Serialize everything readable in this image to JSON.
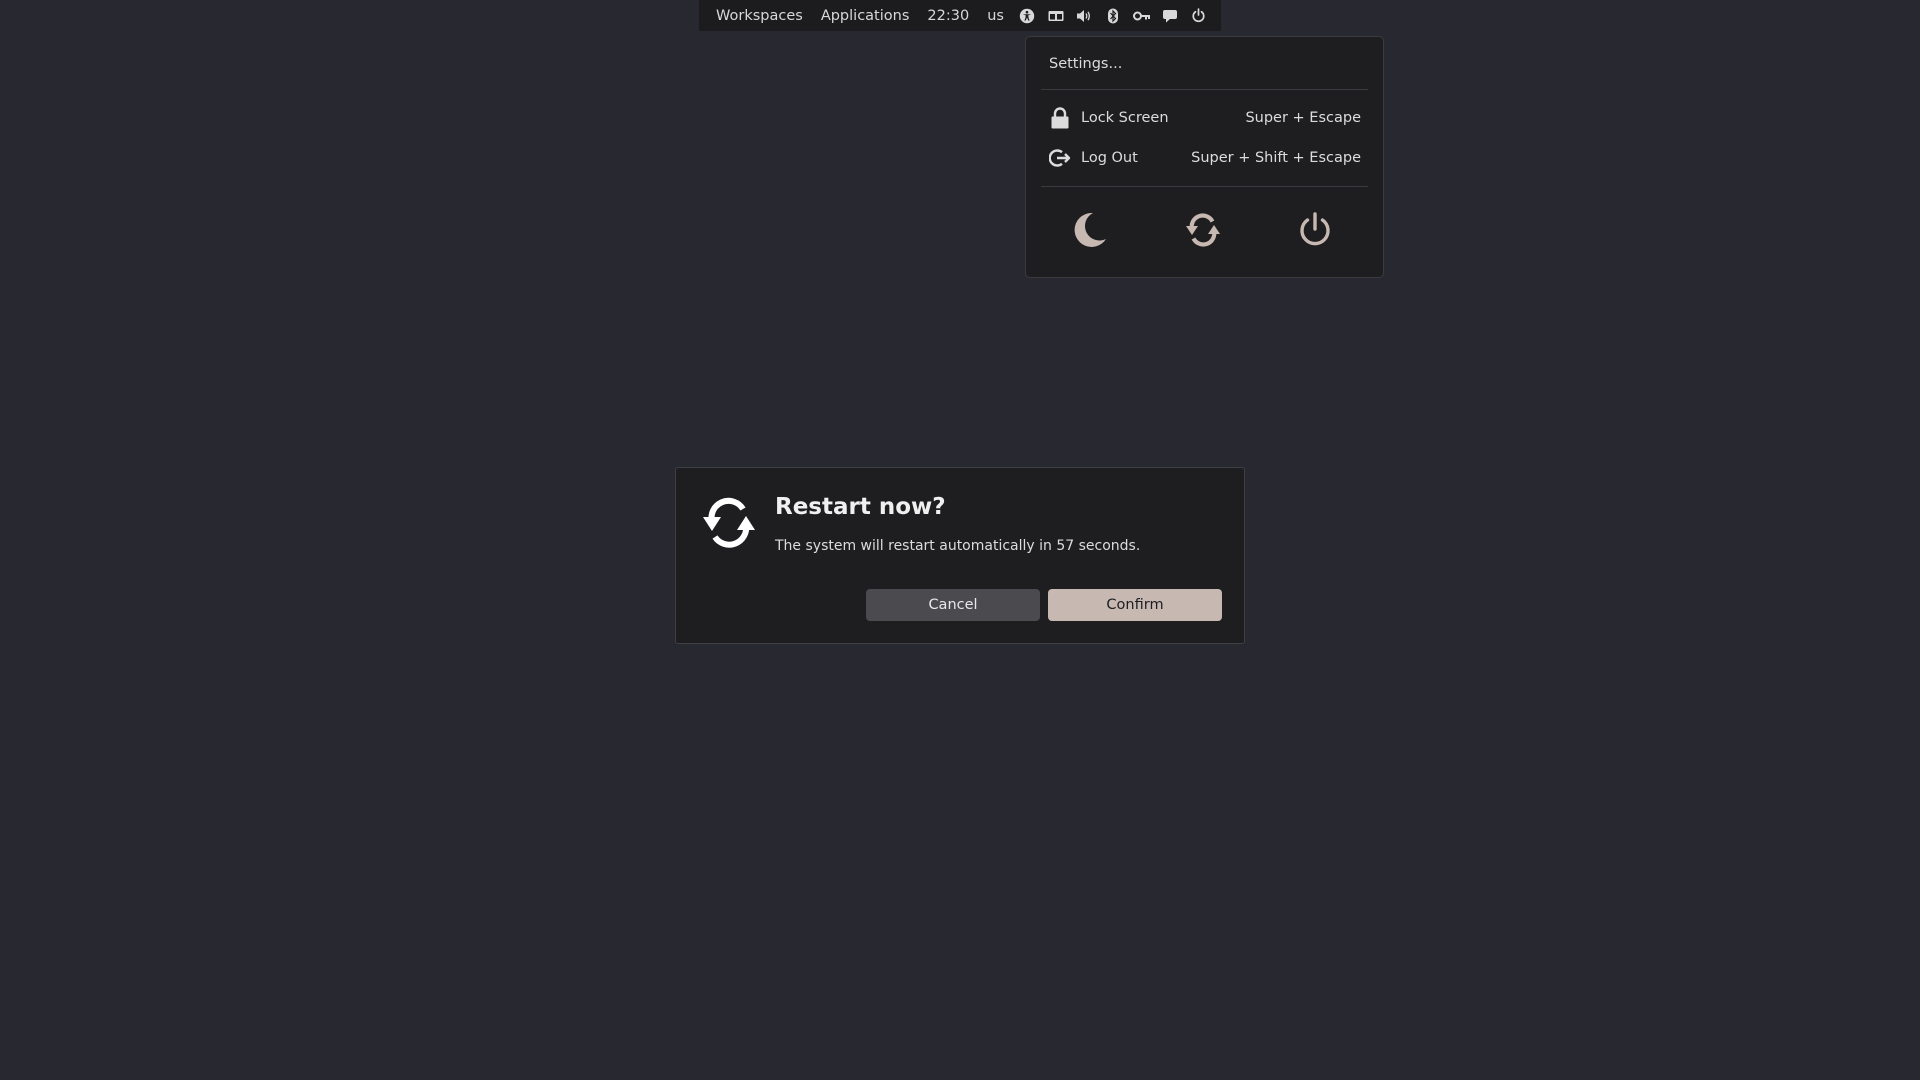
{
  "panel": {
    "workspaces": "Workspaces",
    "applications": "Applications",
    "clock": "22:30",
    "keyboard_layout": "us",
    "icons": [
      "accessibility-icon",
      "window-switcher-icon",
      "volume-icon",
      "bluetooth-icon",
      "key-icon",
      "chat-icon",
      "power-icon"
    ]
  },
  "system_menu": {
    "settings": "Settings...",
    "lock_screen": {
      "label": "Lock Screen",
      "shortcut": "Super + Escape"
    },
    "log_out": {
      "label": "Log Out",
      "shortcut": "Super + Shift + Escape"
    },
    "power_actions": [
      "moon-icon",
      "restart-icon",
      "power-icon"
    ],
    "accent_color": "#c7b8b2"
  },
  "dialog": {
    "title": "Restart now?",
    "body": "The system will restart automatically in 57 seconds.",
    "cancel_label": "Cancel",
    "confirm_label": "Confirm"
  },
  "colors": {
    "background": "#282830",
    "panel": "#1c1c1f",
    "surface": "#1e1e21",
    "accent": "#c7b8b2"
  }
}
